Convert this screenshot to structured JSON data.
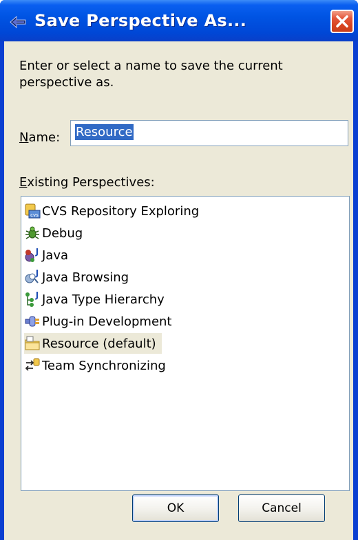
{
  "window": {
    "title": "Save Perspective As..."
  },
  "dialog": {
    "intro_text": "Enter or select a name to save the current perspective as.",
    "name_label_prefix": "",
    "name_label_mnemonic": "N",
    "name_label_rest": "ame:",
    "name_value": "Resource",
    "existing_label_mnemonic": "E",
    "existing_label_rest": "xisting Perspectives:"
  },
  "perspectives": [
    {
      "label": "CVS Repository Exploring",
      "icon": "cvs-repository-icon"
    },
    {
      "label": "Debug",
      "icon": "debug-bug-icon"
    },
    {
      "label": "Java",
      "icon": "java-icon"
    },
    {
      "label": "Java Browsing",
      "icon": "java-browsing-icon"
    },
    {
      "label": "Java Type Hierarchy",
      "icon": "java-type-hierarchy-icon"
    },
    {
      "label": "Plug-in Development",
      "icon": "plugin-development-icon"
    },
    {
      "label": "Resource (default)",
      "icon": "resource-folder-icon",
      "selected": true
    },
    {
      "label": "Team Synchronizing",
      "icon": "team-synchronizing-icon"
    }
  ],
  "buttons": {
    "ok": "OK",
    "cancel": "Cancel"
  },
  "colors": {
    "titlebar": "#0054e3",
    "dialog_bg": "#ece9d8",
    "selection": "#316ac5",
    "close_button": "#d8431f"
  }
}
